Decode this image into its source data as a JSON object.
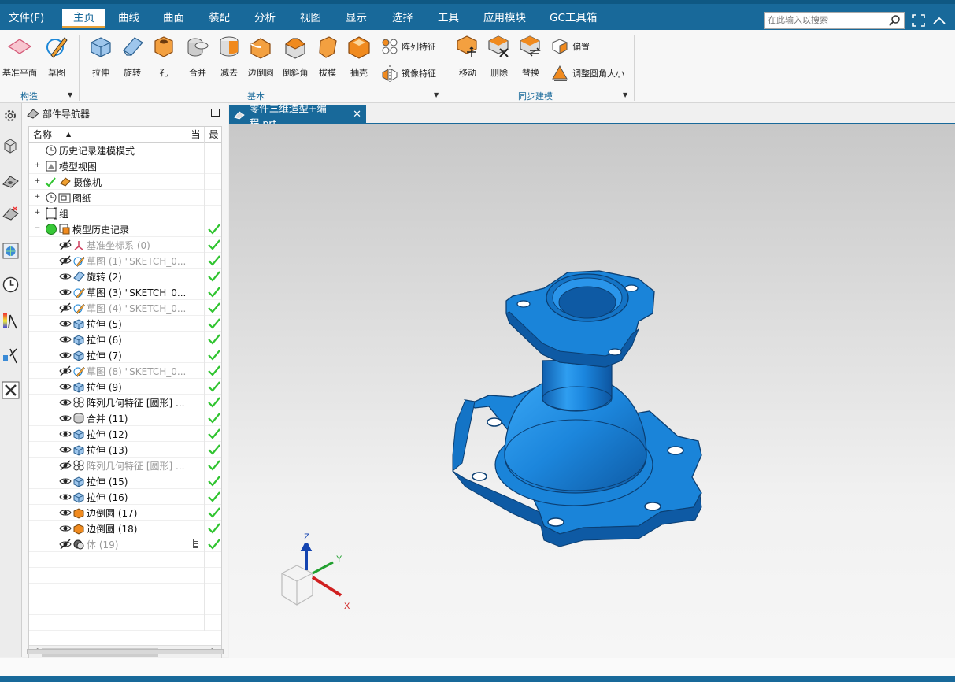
{
  "menubar": {
    "items": [
      "文件(F)",
      "主页",
      "曲线",
      "曲面",
      "装配",
      "分析",
      "视图",
      "显示",
      "选择",
      "工具",
      "应用模块",
      "GC工具箱"
    ],
    "active": "主页",
    "search_placeholder": "在此输入以搜索"
  },
  "ribbon": {
    "construct": {
      "group_label": "构造",
      "datum_plane": "基准平面",
      "sketch": "草图"
    },
    "basic": {
      "group_label": "基本",
      "tools": [
        "拉伸",
        "旋转",
        "孔",
        "合并",
        "减去",
        "边倒圆",
        "倒斜角",
        "拔模",
        "抽壳"
      ],
      "pattern": "阵列特征",
      "mirror": "镜像特征"
    },
    "sync": {
      "group_label": "同步建模",
      "tools": [
        "移动",
        "删除",
        "替换"
      ],
      "offset": "偏置",
      "resize_blend": "调整圆角大小"
    }
  },
  "navigator": {
    "title": "部件导航器",
    "columns": {
      "name": "名称",
      "current": "当",
      "latest": "最"
    },
    "top_nodes": [
      "历史记录建模模式",
      "模型视图",
      "摄像机",
      "图纸",
      "组",
      "模型历史记录"
    ],
    "features": [
      {
        "label": "基准坐标系 (0)",
        "grey": true
      },
      {
        "label": "草图 (1) \"SKETCH_0...",
        "grey": true
      },
      {
        "label": "旋转 (2)",
        "grey": false
      },
      {
        "label": "草图 (3) \"SKETCH_0...",
        "grey": false
      },
      {
        "label": "草图 (4) \"SKETCH_0...",
        "grey": true
      },
      {
        "label": "拉伸 (5)",
        "grey": false
      },
      {
        "label": "拉伸 (6)",
        "grey": false
      },
      {
        "label": "拉伸 (7)",
        "grey": false
      },
      {
        "label": "草图 (8) \"SKETCH_0...",
        "grey": true
      },
      {
        "label": "拉伸 (9)",
        "grey": false
      },
      {
        "label": "阵列几何特征 [圆形] ...",
        "grey": false
      },
      {
        "label": "合并 (11)",
        "grey": false
      },
      {
        "label": "拉伸 (12)",
        "grey": false
      },
      {
        "label": "拉伸 (13)",
        "grey": false
      },
      {
        "label": "阵列几何特征 [圆形] ...",
        "grey": true
      },
      {
        "label": "拉伸 (15)",
        "grey": false
      },
      {
        "label": "拉伸 (16)",
        "grey": false
      },
      {
        "label": "边倒圆 (17)",
        "grey": false
      },
      {
        "label": "边倒圆 (18)",
        "grey": false
      },
      {
        "label": "体 (19)",
        "grey": true
      }
    ]
  },
  "document": {
    "tab_title": "零件三维造型+编程.prt"
  },
  "triad": {
    "x": "X",
    "y": "Y",
    "z": "Z"
  },
  "colors": {
    "accent": "#18699a",
    "part": "#1e88d8",
    "check": "#2fc42f",
    "orange": "#f08a1e"
  }
}
